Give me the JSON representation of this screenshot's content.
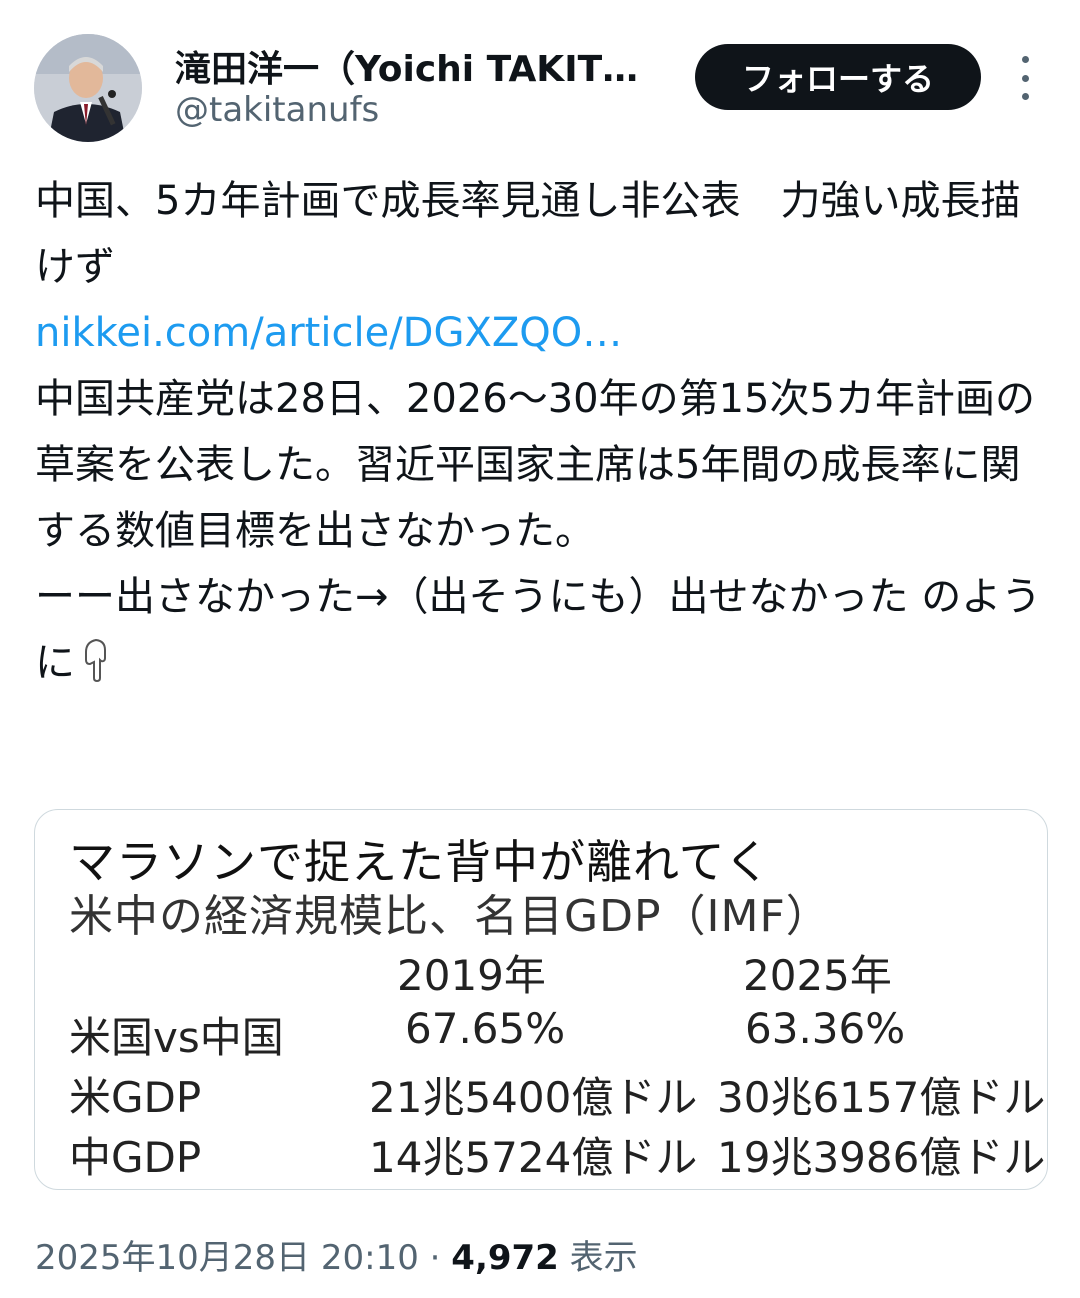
{
  "author": {
    "display_name": "滝田洋一（Yoichi TAKIT…",
    "handle": "@takitanufs",
    "follow_label": "フォローする"
  },
  "tweet": {
    "headline": "中国、5カ年計画で成長率見通し非公表　力強い成長描けず",
    "link": "nikkei.com/article/DGXZQO…",
    "paragraph": "中国共産党は28日、2026〜30年の第15次5カ年計画の草案を公表した。習近平国家主席は5年間の成長率に関する数値目標を出さなかった。",
    "comment": "ーー出さなかった→（出そうにも）出せなかった のように"
  },
  "image": {
    "title": "マラソンで捉えた背中が離れてく",
    "subtitle": "米中の経済規模比、名目GDP（IMF）",
    "columns": [
      "2019年",
      "2025年"
    ],
    "rows": [
      {
        "label": "米国vs中国",
        "values": [
          "67.65%",
          "63.36%"
        ]
      },
      {
        "label": "米GDP",
        "values": [
          "21兆5400億ドル",
          "30兆6157億ドル"
        ]
      },
      {
        "label": "中GDP",
        "values": [
          "14兆5724億ドル",
          "19兆3986億ドル"
        ]
      }
    ]
  },
  "meta": {
    "timestamp": "2025年10月28日 20:10",
    "separator": "·",
    "views_count": "4,972",
    "views_label": "表示"
  },
  "icons": {
    "emoji": "pointing-down-hand-icon",
    "more": "more-vertical-icon"
  }
}
